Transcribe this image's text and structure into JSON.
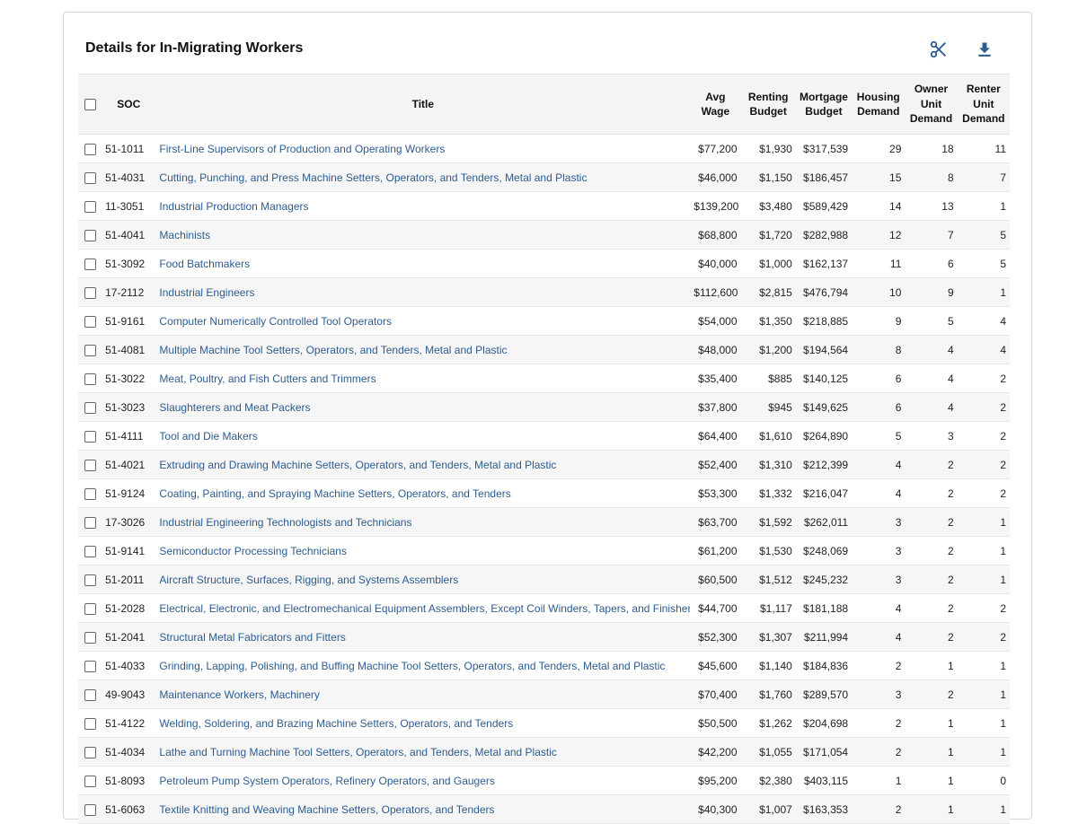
{
  "card": {
    "title": "Details for In-Migrating Workers",
    "tools": [
      {
        "name": "scissors-icon",
        "label": "Trim"
      },
      {
        "name": "download-icon",
        "label": "Download"
      }
    ],
    "accent_color": "#2c5c8f"
  },
  "table": {
    "headers": {
      "soc": "SOC",
      "title": "Title",
      "avg_wage": [
        "Avg",
        "Wage"
      ],
      "renting_budget": [
        "Renting",
        "Budget"
      ],
      "mortgage_budget": [
        "Mortgage",
        "Budget"
      ],
      "housing_demand": [
        "Housing",
        "Demand"
      ],
      "owner_unit_demand": [
        "Owner",
        "Unit",
        "Demand"
      ],
      "renter_unit_demand": [
        "Renter",
        "Unit",
        "Demand"
      ]
    },
    "rows": [
      {
        "soc": "51-1011",
        "title": "First-Line Supervisors of Production and Operating Workers",
        "avg_wage": "$77,200",
        "renting_budget": "$1,930",
        "mortgage_budget": "$317,539",
        "housing_demand": "29",
        "owner": "18",
        "renter": "11"
      },
      {
        "soc": "51-4031",
        "title": "Cutting, Punching, and Press Machine Setters, Operators, and Tenders, Metal and Plastic",
        "avg_wage": "$46,000",
        "renting_budget": "$1,150",
        "mortgage_budget": "$186,457",
        "housing_demand": "15",
        "owner": "8",
        "renter": "7"
      },
      {
        "soc": "11-3051",
        "title": "Industrial Production Managers",
        "avg_wage": "$139,200",
        "renting_budget": "$3,480",
        "mortgage_budget": "$589,429",
        "housing_demand": "14",
        "owner": "13",
        "renter": "1"
      },
      {
        "soc": "51-4041",
        "title": "Machinists",
        "avg_wage": "$68,800",
        "renting_budget": "$1,720",
        "mortgage_budget": "$282,988",
        "housing_demand": "12",
        "owner": "7",
        "renter": "5"
      },
      {
        "soc": "51-3092",
        "title": "Food Batchmakers",
        "avg_wage": "$40,000",
        "renting_budget": "$1,000",
        "mortgage_budget": "$162,137",
        "housing_demand": "11",
        "owner": "6",
        "renter": "5"
      },
      {
        "soc": "17-2112",
        "title": "Industrial Engineers",
        "avg_wage": "$112,600",
        "renting_budget": "$2,815",
        "mortgage_budget": "$476,794",
        "housing_demand": "10",
        "owner": "9",
        "renter": "1"
      },
      {
        "soc": "51-9161",
        "title": "Computer Numerically Controlled Tool Operators",
        "avg_wage": "$54,000",
        "renting_budget": "$1,350",
        "mortgage_budget": "$218,885",
        "housing_demand": "9",
        "owner": "5",
        "renter": "4"
      },
      {
        "soc": "51-4081",
        "title": "Multiple Machine Tool Setters, Operators, and Tenders, Metal and Plastic",
        "avg_wage": "$48,000",
        "renting_budget": "$1,200",
        "mortgage_budget": "$194,564",
        "housing_demand": "8",
        "owner": "4",
        "renter": "4"
      },
      {
        "soc": "51-3022",
        "title": "Meat, Poultry, and Fish Cutters and Trimmers",
        "avg_wage": "$35,400",
        "renting_budget": "$885",
        "mortgage_budget": "$140,125",
        "housing_demand": "6",
        "owner": "4",
        "renter": "2"
      },
      {
        "soc": "51-3023",
        "title": "Slaughterers and Meat Packers",
        "avg_wage": "$37,800",
        "renting_budget": "$945",
        "mortgage_budget": "$149,625",
        "housing_demand": "6",
        "owner": "4",
        "renter": "2"
      },
      {
        "soc": "51-4111",
        "title": "Tool and Die Makers",
        "avg_wage": "$64,400",
        "renting_budget": "$1,610",
        "mortgage_budget": "$264,890",
        "housing_demand": "5",
        "owner": "3",
        "renter": "2"
      },
      {
        "soc": "51-4021",
        "title": "Extruding and Drawing Machine Setters, Operators, and Tenders, Metal and Plastic",
        "avg_wage": "$52,400",
        "renting_budget": "$1,310",
        "mortgage_budget": "$212,399",
        "housing_demand": "4",
        "owner": "2",
        "renter": "2"
      },
      {
        "soc": "51-9124",
        "title": "Coating, Painting, and Spraying Machine Setters, Operators, and Tenders",
        "avg_wage": "$53,300",
        "renting_budget": "$1,332",
        "mortgage_budget": "$216,047",
        "housing_demand": "4",
        "owner": "2",
        "renter": "2"
      },
      {
        "soc": "17-3026",
        "title": "Industrial Engineering Technologists and Technicians",
        "avg_wage": "$63,700",
        "renting_budget": "$1,592",
        "mortgage_budget": "$262,011",
        "housing_demand": "3",
        "owner": "2",
        "renter": "1"
      },
      {
        "soc": "51-9141",
        "title": "Semiconductor Processing Technicians",
        "avg_wage": "$61,200",
        "renting_budget": "$1,530",
        "mortgage_budget": "$248,069",
        "housing_demand": "3",
        "owner": "2",
        "renter": "1"
      },
      {
        "soc": "51-2011",
        "title": "Aircraft Structure, Surfaces, Rigging, and Systems Assemblers",
        "avg_wage": "$60,500",
        "renting_budget": "$1,512",
        "mortgage_budget": "$245,232",
        "housing_demand": "3",
        "owner": "2",
        "renter": "1"
      },
      {
        "soc": "51-2028",
        "title": "Electrical, Electronic, and Electromechanical Equipment Assemblers, Except Coil Winders, Tapers, and Finishers",
        "avg_wage": "$44,700",
        "renting_budget": "$1,117",
        "mortgage_budget": "$181,188",
        "housing_demand": "4",
        "owner": "2",
        "renter": "2"
      },
      {
        "soc": "51-2041",
        "title": "Structural Metal Fabricators and Fitters",
        "avg_wage": "$52,300",
        "renting_budget": "$1,307",
        "mortgage_budget": "$211,994",
        "housing_demand": "4",
        "owner": "2",
        "renter": "2"
      },
      {
        "soc": "51-4033",
        "title": "Grinding, Lapping, Polishing, and Buffing Machine Tool Setters, Operators, and Tenders, Metal and Plastic",
        "avg_wage": "$45,600",
        "renting_budget": "$1,140",
        "mortgage_budget": "$184,836",
        "housing_demand": "2",
        "owner": "1",
        "renter": "1"
      },
      {
        "soc": "49-9043",
        "title": "Maintenance Workers, Machinery",
        "avg_wage": "$70,400",
        "renting_budget": "$1,760",
        "mortgage_budget": "$289,570",
        "housing_demand": "3",
        "owner": "2",
        "renter": "1"
      },
      {
        "soc": "51-4122",
        "title": "Welding, Soldering, and Brazing Machine Setters, Operators, and Tenders",
        "avg_wage": "$50,500",
        "renting_budget": "$1,262",
        "mortgage_budget": "$204,698",
        "housing_demand": "2",
        "owner": "1",
        "renter": "1"
      },
      {
        "soc": "51-4034",
        "title": "Lathe and Turning Machine Tool Setters, Operators, and Tenders, Metal and Plastic",
        "avg_wage": "$42,200",
        "renting_budget": "$1,055",
        "mortgage_budget": "$171,054",
        "housing_demand": "2",
        "owner": "1",
        "renter": "1"
      },
      {
        "soc": "51-8093",
        "title": "Petroleum Pump System Operators, Refinery Operators, and Gaugers",
        "avg_wage": "$95,200",
        "renting_budget": "$2,380",
        "mortgage_budget": "$403,115",
        "housing_demand": "1",
        "owner": "1",
        "renter": "0"
      },
      {
        "soc": "51-6063",
        "title": "Textile Knitting and Weaving Machine Setters, Operators, and Tenders",
        "avg_wage": "$40,300",
        "renting_budget": "$1,007",
        "mortgage_budget": "$163,353",
        "housing_demand": "2",
        "owner": "1",
        "renter": "1"
      }
    ]
  }
}
